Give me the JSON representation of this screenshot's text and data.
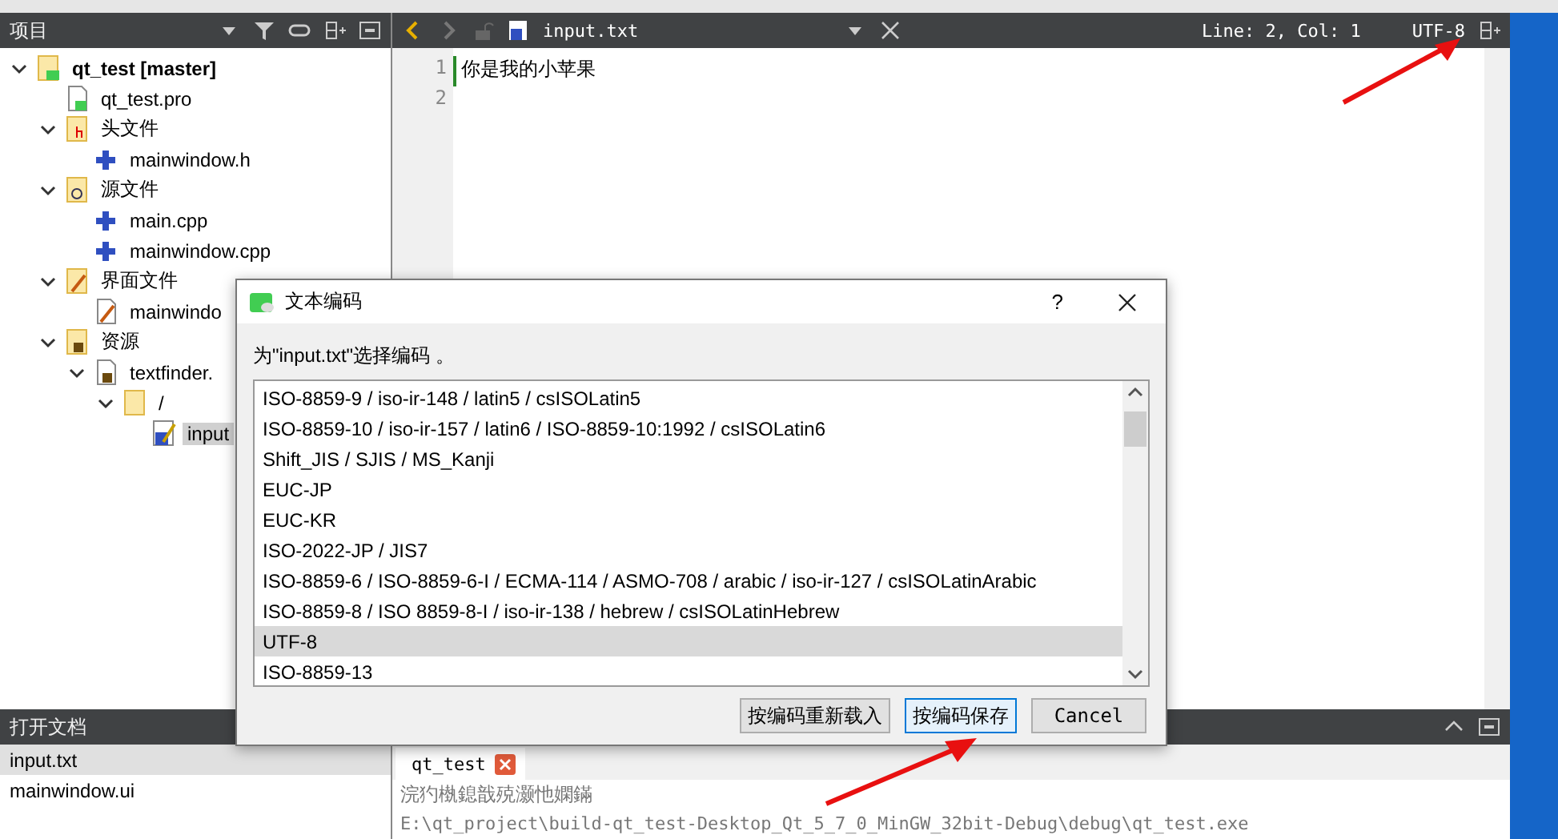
{
  "project_panel": {
    "title": "项目",
    "tree": [
      {
        "label": "qt_test [master]",
        "expanded": true,
        "selected": false,
        "children": [
          {
            "label": "qt_test.pro",
            "selected": false
          },
          {
            "label": "头文件",
            "expanded": true,
            "selected": false,
            "children": [
              {
                "label": "mainwindow.h",
                "selected": false
              }
            ]
          },
          {
            "label": "源文件",
            "expanded": true,
            "selected": false,
            "children": [
              {
                "label": "main.cpp",
                "selected": false
              },
              {
                "label": "mainwindow.cpp",
                "selected": false
              }
            ]
          },
          {
            "label": "界面文件",
            "expanded": true,
            "selected": false,
            "children": [
              {
                "label": "mainwindo",
                "selected": false
              }
            ]
          },
          {
            "label": "资源",
            "expanded": true,
            "selected": false,
            "children": [
              {
                "label": "textfinder.",
                "expanded": true,
                "selected": false,
                "children": [
                  {
                    "label": "/",
                    "expanded": true,
                    "selected": false,
                    "children": [
                      {
                        "label": "input",
                        "selected": true
                      }
                    ]
                  }
                ]
              }
            ]
          }
        ]
      }
    ]
  },
  "editor": {
    "file_name": "input.txt",
    "position": "Line: 2, Col: 1",
    "encoding": "UTF-8",
    "lines": [
      {
        "number": "1",
        "text": "你是我的小苹果",
        "current": true
      },
      {
        "number": "2",
        "current": false
      }
    ]
  },
  "open_documents": {
    "title": "打开文档",
    "items": [
      {
        "label": "input.txt",
        "selected": true
      },
      {
        "label": "mainwindow.ui",
        "selected": false
      }
    ]
  },
  "output": {
    "tab": "qt_test",
    "lines": [
      "浣犳槸鎴戠殑灏忚嫻鏋",
      "E:\\qt_project\\build-qt_test-Desktop_Qt_5_7_0_MinGW_32bit-Debug\\debug\\qt_test.exe"
    ]
  },
  "dialog": {
    "title": "文本编码",
    "help": "?",
    "prompt": "为\"input.txt\"选择编码 。",
    "encodings": [
      {
        "label": "ISO-8859-9 / iso-ir-148 / latin5 / csISOLatin5",
        "selected": false
      },
      {
        "label": "ISO-8859-10 / iso-ir-157 / latin6 / ISO-8859-10:1992 / csISOLatin6",
        "selected": false
      },
      {
        "label": "Shift_JIS / SJIS / MS_Kanji",
        "selected": false
      },
      {
        "label": "EUC-JP",
        "selected": false
      },
      {
        "label": "EUC-KR",
        "selected": false
      },
      {
        "label": "ISO-2022-JP / JIS7",
        "selected": false
      },
      {
        "label": "ISO-8859-6 / ISO-8859-6-I / ECMA-114 / ASMO-708 / arabic / iso-ir-127 / csISOLatinArabic",
        "selected": false
      },
      {
        "label": "ISO-8859-8 / ISO 8859-8-I / iso-ir-138 / hebrew / csISOLatinHebrew",
        "selected": false
      },
      {
        "label": "UTF-8",
        "selected": true
      },
      {
        "label": "ISO-8859-13",
        "selected": false
      }
    ],
    "buttons": [
      {
        "label": "按编码重新载入",
        "kind": "normal"
      },
      {
        "label": "按编码保存",
        "kind": "focused"
      },
      {
        "label": "Cancel",
        "kind": "mono"
      }
    ]
  }
}
